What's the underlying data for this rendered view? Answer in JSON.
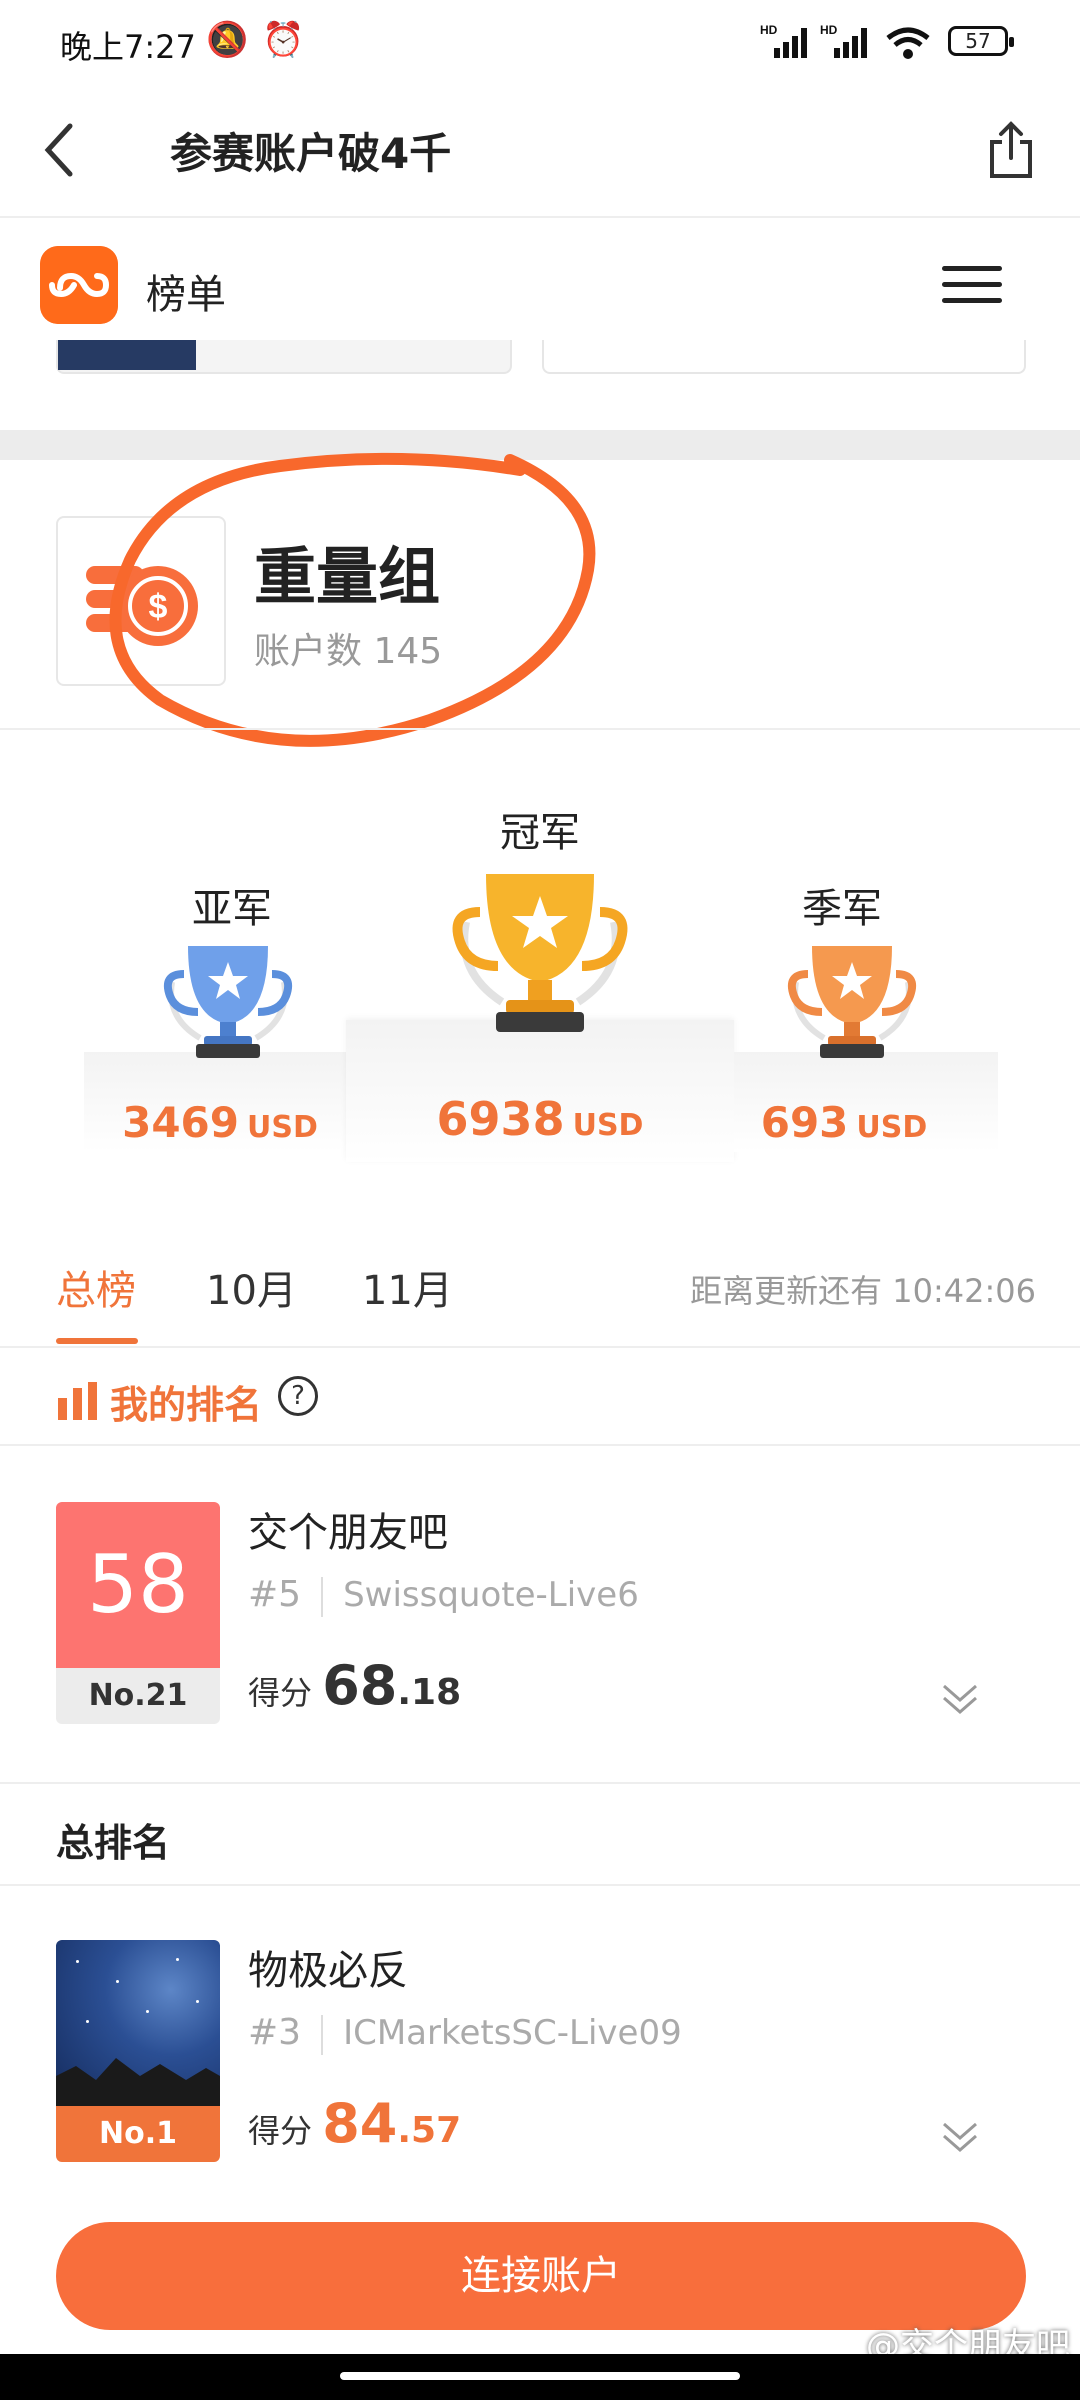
{
  "status_bar": {
    "time": "晚上7:27",
    "battery": "57",
    "icons": [
      "mute-icon",
      "alarm-icon",
      "signal-hd-icon",
      "signal-hd-icon",
      "wifi-icon",
      "battery-icon"
    ],
    "net_labels": [
      "HD",
      "HD"
    ]
  },
  "nav": {
    "title": "参赛账户破4千"
  },
  "app_bar": {
    "name": "榜单"
  },
  "group": {
    "name": "重量组",
    "account_count": "账户数 145"
  },
  "podium": {
    "first": {
      "label": "冠军",
      "amount": "6938",
      "unit": "USD"
    },
    "second": {
      "label": "亚军",
      "amount": "3469",
      "unit": "USD"
    },
    "third": {
      "label": "季军",
      "amount": "693",
      "unit": "USD"
    }
  },
  "tabs": {
    "items": [
      {
        "label": "总榜",
        "active": true
      },
      {
        "label": "10月",
        "active": false
      },
      {
        "label": "11月",
        "active": false
      }
    ],
    "countdown": "距离更新还有 10:42:06"
  },
  "my_rank": {
    "heading": "我的排名",
    "entry": {
      "score_badge": "58",
      "rank": "No.21",
      "name": "交个朋友吧",
      "sub_rank": "#5",
      "server": "Swissquote-Live6",
      "score_label": "得分",
      "score_int": "68",
      "score_dec": ".18"
    }
  },
  "total_rank": {
    "heading": "总排名",
    "entries": [
      {
        "rank": "No.1",
        "name": "物极必反",
        "sub_rank": "#3",
        "server": "ICMarketsSC-Live09",
        "score_label": "得分",
        "score_int": "84",
        "score_dec": ".57"
      }
    ]
  },
  "bottom": {
    "connect_label": "连接账户",
    "watermark": "@交个朋友吧"
  },
  "colors": {
    "accent": "#f0743a",
    "button": "#f86e3c",
    "score_badge": "#fd7470",
    "logo": "#ff6a1a",
    "gold": "#f5a623",
    "silver": "#5b8fdc",
    "bronze": "#f08a45"
  }
}
